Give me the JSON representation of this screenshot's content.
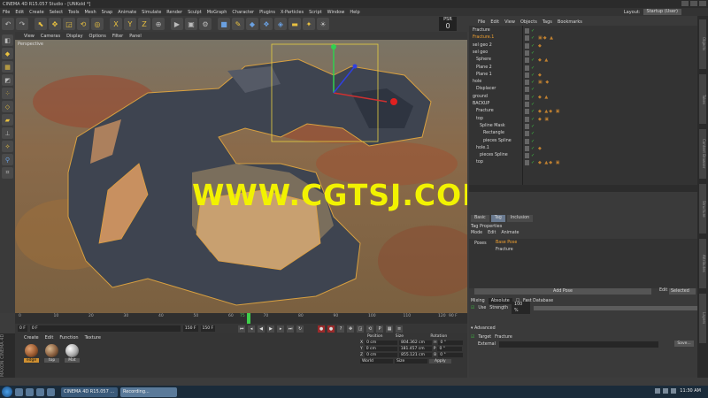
{
  "window": {
    "title": "CINEMA 4D R15.057 Studio - [UNKold *]"
  },
  "menubar": {
    "items": [
      "File",
      "Edit",
      "Create",
      "Select",
      "Tools",
      "Mesh",
      "Snap",
      "Animate",
      "Simulate",
      "Render",
      "Sculpt",
      "MoGraph",
      "Character",
      "Plugins",
      "X-Particles",
      "Script",
      "Window",
      "Help"
    ],
    "layout_label": "Layout:",
    "layout_value": "Startup (User)"
  },
  "psr": {
    "label": "PSR",
    "value": "0"
  },
  "viewport": {
    "menu": [
      "View",
      "Cameras",
      "Display",
      "Options",
      "Filter",
      "Panel"
    ],
    "camera_label": "Perspective"
  },
  "watermark": "WWW.CGTSJ.COM",
  "timeline": {
    "ticks": [
      "0",
      "10",
      "20",
      "30",
      "40",
      "50",
      "60",
      "70",
      "80",
      "90",
      "100",
      "110",
      "120"
    ],
    "end_label": "90 F",
    "current": "75"
  },
  "transport": {
    "start_field": "0 F",
    "current_field": "0 F",
    "end_field": "150 F",
    "end_field2": "150 F"
  },
  "materials": {
    "menu": [
      "Create",
      "Edit",
      "Function",
      "Texture"
    ],
    "side_label": "MAXON CINEMA 4D",
    "items": [
      {
        "label": "edge",
        "selected": true
      },
      {
        "label": "top",
        "selected": false
      },
      {
        "label": "Mat",
        "selected": false
      }
    ]
  },
  "coordinates": {
    "headers": [
      "Position",
      "Size",
      "Rotation"
    ],
    "rows": [
      {
        "axis": "X",
        "pos": "0 cm",
        "size": "804.362 cm",
        "rot_axis": "H",
        "rot": "0 °"
      },
      {
        "axis": "Y",
        "pos": "0 cm",
        "size": "181.457 cm",
        "rot_axis": "P",
        "rot": "0 °"
      },
      {
        "axis": "Z",
        "pos": "0 cm",
        "size": "855.121 cm",
        "rot_axis": "B",
        "rot": "0 °"
      }
    ],
    "mode": "World",
    "size_mode": "Size",
    "apply_label": "Apply"
  },
  "object_manager": {
    "menu": [
      "File",
      "Edit",
      "View",
      "Objects",
      "Tags",
      "Bookmarks"
    ],
    "objects": [
      {
        "name": "Fracture",
        "indent": 0,
        "highlight": false,
        "tags": ""
      },
      {
        "name": "Fracture.1",
        "indent": 0,
        "highlight": true,
        "tags": "▣◆ ▲"
      },
      {
        "name": "sel geo 2",
        "indent": 0,
        "highlight": false,
        "tags": "◆"
      },
      {
        "name": "sel geo",
        "indent": 0,
        "highlight": false,
        "tags": ""
      },
      {
        "name": "Sphere",
        "indent": 1,
        "highlight": false,
        "tags": "◆ ▲"
      },
      {
        "name": "Plane 2",
        "indent": 1,
        "highlight": false,
        "tags": ""
      },
      {
        "name": "Plane 1",
        "indent": 1,
        "highlight": false,
        "tags": "◆"
      },
      {
        "name": "hole",
        "indent": 0,
        "highlight": false,
        "tags": "▣ ◆"
      },
      {
        "name": "Displacer",
        "indent": 1,
        "highlight": false,
        "tags": ""
      },
      {
        "name": "ground",
        "indent": 0,
        "highlight": false,
        "tags": "◆ ▲"
      },
      {
        "name": "BACKUP",
        "indent": 0,
        "highlight": false,
        "tags": ""
      },
      {
        "name": "Fracture",
        "indent": 1,
        "highlight": false,
        "tags": "◆ ▲◆ ▣"
      },
      {
        "name": "top",
        "indent": 1,
        "highlight": false,
        "tags": "◆ ▣"
      },
      {
        "name": "Spline Mask",
        "indent": 2,
        "highlight": false,
        "tags": ""
      },
      {
        "name": "Rectangle",
        "indent": 3,
        "highlight": false,
        "tags": ""
      },
      {
        "name": "pieces Spline",
        "indent": 3,
        "highlight": false,
        "tags": ""
      },
      {
        "name": "hole.1",
        "indent": 1,
        "highlight": false,
        "tags": "◆"
      },
      {
        "name": "pieces Spline",
        "indent": 2,
        "highlight": false,
        "tags": ""
      },
      {
        "name": "top",
        "indent": 1,
        "highlight": false,
        "tags": "◆ ▲◆ ▣"
      }
    ]
  },
  "attributes": {
    "tabs": [
      {
        "label": "Basic",
        "selected": false
      },
      {
        "label": "Tag",
        "selected": true
      },
      {
        "label": "Inclusion",
        "selected": false
      }
    ],
    "title": "Tag Properties",
    "sub": [
      "Mode",
      "Edit",
      "Animate"
    ],
    "poses_label": "Poses",
    "poses": [
      {
        "name": "Base Pose",
        "highlight": true
      },
      {
        "name": "Fracture",
        "highlight": false
      }
    ],
    "add_pose_label": "Add Pose",
    "edit_label": "Edit",
    "edit_value": "Selected",
    "mixing_label": "Mixing",
    "mixing_value": "Absolute",
    "fast_database_label": "Fast Database",
    "use_label": "Use",
    "strength_label": "Strength",
    "strength_value": "100 %",
    "advanced_label": "Advanced",
    "target_label": "Target",
    "target_value": "Fracture",
    "external_label": "External",
    "save_label": "Save..."
  },
  "side_tabs": [
    "Objects",
    "Takes",
    "Content Browser",
    "Structure",
    "Attributes",
    "Layers"
  ],
  "taskbar": {
    "tasks": [
      {
        "label": "CINEMA 4D R15.057 ...",
        "active": false
      },
      {
        "label": "Recording...",
        "active": true
      }
    ],
    "clock": "11:30 AM"
  }
}
